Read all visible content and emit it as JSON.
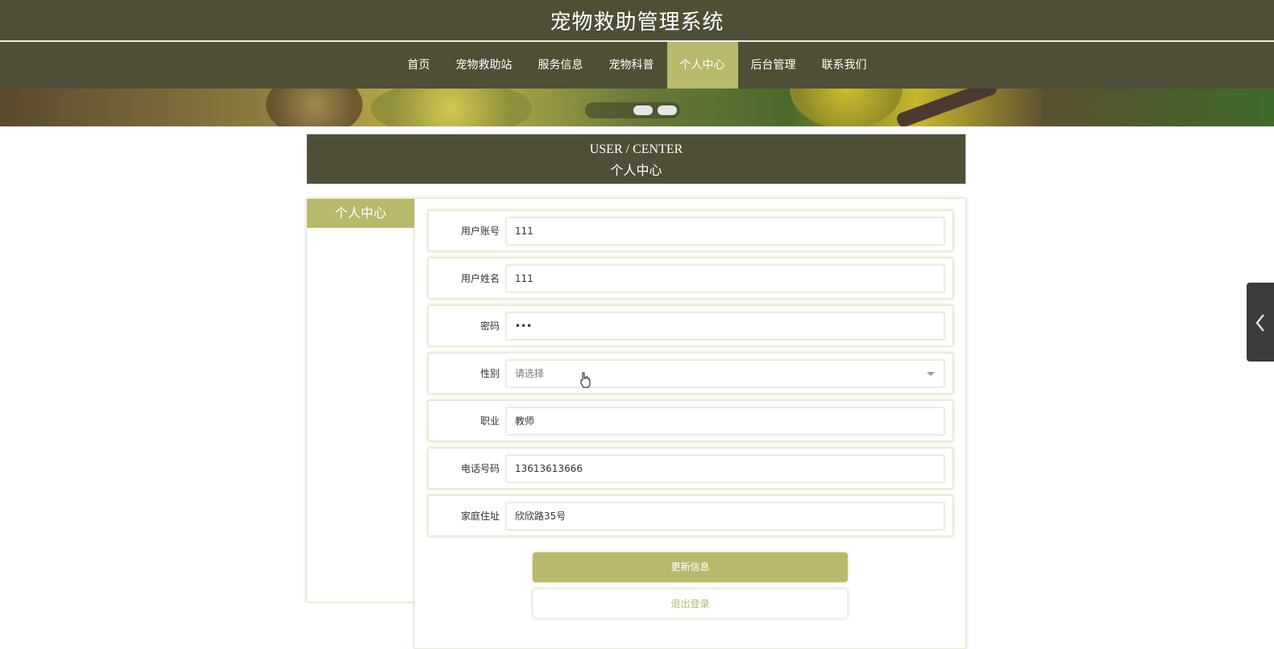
{
  "header": {
    "title": "宠物救助管理系统"
  },
  "nav": {
    "items": [
      {
        "label": "首页"
      },
      {
        "label": "宠物救助站"
      },
      {
        "label": "服务信息"
      },
      {
        "label": "宠物科普"
      },
      {
        "label": "个人中心"
      },
      {
        "label": "后台管理"
      },
      {
        "label": "联系我们"
      }
    ],
    "active_index": 4
  },
  "section": {
    "title_en": "USER / CENTER",
    "title_zh": "个人中心"
  },
  "sidebar": {
    "heading": "个人中心"
  },
  "form": {
    "fields": [
      {
        "label": "用户账号",
        "value": "111"
      },
      {
        "label": "用户姓名",
        "value": "111"
      },
      {
        "label": "密码",
        "value": "•••"
      },
      {
        "label": "性别",
        "value": "",
        "placeholder": "请选择"
      },
      {
        "label": "职业",
        "value": "教师"
      },
      {
        "label": "电话号码",
        "value": "13613613666"
      },
      {
        "label": "家庭住址",
        "value": "欣欣路35号"
      }
    ],
    "update_label": "更新信息",
    "logout_label": "退出登录"
  },
  "colors": {
    "primary": "#4f4e37",
    "accent": "#b8b96d"
  },
  "icons": {
    "side_toggle": "chevron-left-icon"
  }
}
